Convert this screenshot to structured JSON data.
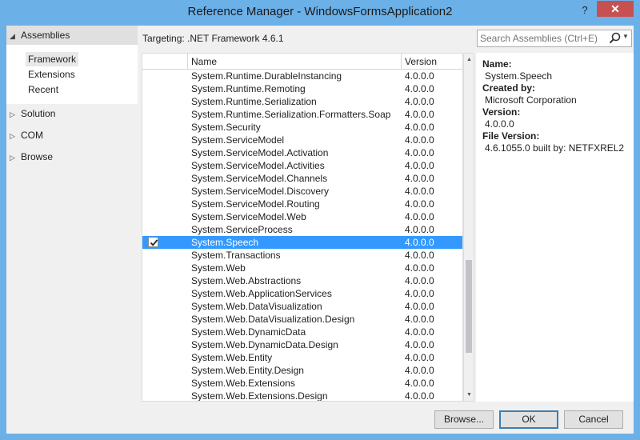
{
  "window": {
    "title": "Reference Manager - WindowsFormsApplication2",
    "help_label": "?",
    "close_label": "✕"
  },
  "nav": {
    "assemblies": {
      "label": "Assemblies",
      "arrow": "◢"
    },
    "sub_items": [
      "Framework",
      "Extensions",
      "Recent"
    ],
    "selected_sub_item": "Framework",
    "groups": [
      {
        "label": "Solution",
        "arrow": "▷"
      },
      {
        "label": "COM",
        "arrow": "▷"
      },
      {
        "label": "Browse",
        "arrow": "▷"
      }
    ]
  },
  "targeting": "Targeting: .NET Framework 4.6.1",
  "search": {
    "placeholder": "Search Assemblies (Ctrl+E)",
    "icon": "search-icon"
  },
  "grid": {
    "columns": {
      "check": "",
      "name": "Name",
      "version": "Version"
    },
    "rows": [
      {
        "name": "System.Runtime.DurableInstancing",
        "version": "4.0.0.0",
        "checked": false
      },
      {
        "name": "System.Runtime.Remoting",
        "version": "4.0.0.0",
        "checked": false
      },
      {
        "name": "System.Runtime.Serialization",
        "version": "4.0.0.0",
        "checked": false
      },
      {
        "name": "System.Runtime.Serialization.Formatters.Soap",
        "version": "4.0.0.0",
        "checked": false
      },
      {
        "name": "System.Security",
        "version": "4.0.0.0",
        "checked": false
      },
      {
        "name": "System.ServiceModel",
        "version": "4.0.0.0",
        "checked": false
      },
      {
        "name": "System.ServiceModel.Activation",
        "version": "4.0.0.0",
        "checked": false
      },
      {
        "name": "System.ServiceModel.Activities",
        "version": "4.0.0.0",
        "checked": false
      },
      {
        "name": "System.ServiceModel.Channels",
        "version": "4.0.0.0",
        "checked": false
      },
      {
        "name": "System.ServiceModel.Discovery",
        "version": "4.0.0.0",
        "checked": false
      },
      {
        "name": "System.ServiceModel.Routing",
        "version": "4.0.0.0",
        "checked": false
      },
      {
        "name": "System.ServiceModel.Web",
        "version": "4.0.0.0",
        "checked": false
      },
      {
        "name": "System.ServiceProcess",
        "version": "4.0.0.0",
        "checked": false
      },
      {
        "name": "System.Speech",
        "version": "4.0.0.0",
        "checked": true,
        "selected": true
      },
      {
        "name": "System.Transactions",
        "version": "4.0.0.0",
        "checked": false
      },
      {
        "name": "System.Web",
        "version": "4.0.0.0",
        "checked": false
      },
      {
        "name": "System.Web.Abstractions",
        "version": "4.0.0.0",
        "checked": false
      },
      {
        "name": "System.Web.ApplicationServices",
        "version": "4.0.0.0",
        "checked": false
      },
      {
        "name": "System.Web.DataVisualization",
        "version": "4.0.0.0",
        "checked": false
      },
      {
        "name": "System.Web.DataVisualization.Design",
        "version": "4.0.0.0",
        "checked": false
      },
      {
        "name": "System.Web.DynamicData",
        "version": "4.0.0.0",
        "checked": false
      },
      {
        "name": "System.Web.DynamicData.Design",
        "version": "4.0.0.0",
        "checked": false
      },
      {
        "name": "System.Web.Entity",
        "version": "4.0.0.0",
        "checked": false
      },
      {
        "name": "System.Web.Entity.Design",
        "version": "4.0.0.0",
        "checked": false
      },
      {
        "name": "System.Web.Extensions",
        "version": "4.0.0.0",
        "checked": false
      },
      {
        "name": "System.Web.Extensions.Design",
        "version": "4.0.0.0",
        "checked": false
      }
    ]
  },
  "details": {
    "name_label": "Name:",
    "name_value": "System.Speech",
    "created_by_label": "Created by:",
    "created_by_value": "Microsoft Corporation",
    "version_label": "Version:",
    "version_value": "4.0.0.0",
    "file_version_label": "File Version:",
    "file_version_value": "4.6.1055.0 built by: NETFXREL2"
  },
  "buttons": {
    "browse": "Browse...",
    "ok": "OK",
    "cancel": "Cancel"
  },
  "colors": {
    "titlebar": "#6cb0e8",
    "selection": "#3399ff",
    "close": "#c75050"
  }
}
